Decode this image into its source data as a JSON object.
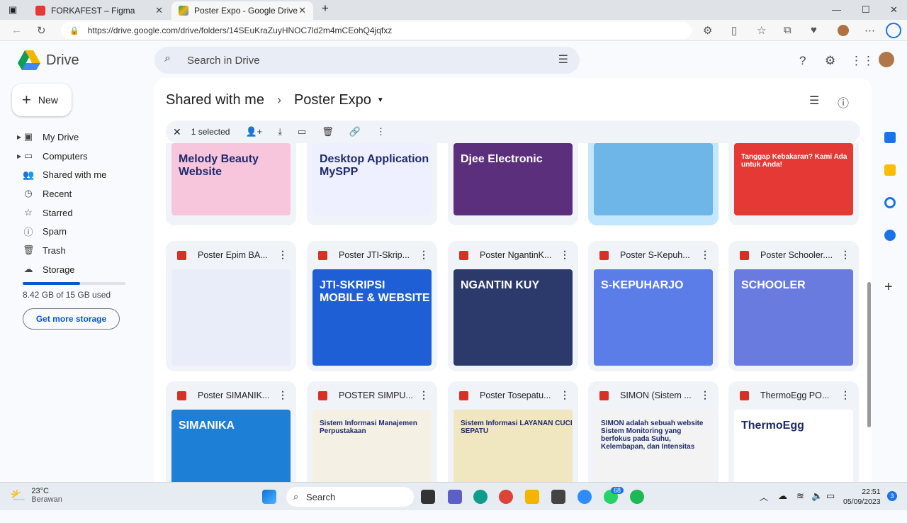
{
  "browser": {
    "tabs": [
      {
        "label": "FORKAFEST – Figma",
        "color": "#e53935"
      },
      {
        "label": "Poster Expo - Google Drive",
        "color": "#1a73e8"
      }
    ],
    "url": "https://drive.google.com/drive/folders/14SEuKraZuyHNOC7ld2m4mCEohQ4jqfxz"
  },
  "drive": {
    "app_name": "Drive",
    "search_placeholder": "Search in Drive",
    "new_label": "New",
    "sidebar": [
      {
        "label": "My Drive",
        "icon": "drive-icon"
      },
      {
        "label": "Computers",
        "icon": "computer-icon"
      },
      {
        "label": "Shared with me",
        "icon": "people-icon"
      },
      {
        "label": "Recent",
        "icon": "clock-icon"
      },
      {
        "label": "Starred",
        "icon": "star-icon"
      },
      {
        "label": "Spam",
        "icon": "spam-icon"
      },
      {
        "label": "Trash",
        "icon": "trash-icon"
      },
      {
        "label": "Storage",
        "icon": "cloud-icon"
      }
    ],
    "storage_text": "8.42 GB of 15 GB used",
    "storage_fraction": 0.56,
    "get_more_label": "Get more storage",
    "breadcrumb": {
      "parent": "Shared with me",
      "current": "Poster Expo"
    },
    "selection": {
      "count_label": "1 selected"
    },
    "files": [
      {
        "name": "",
        "thumb": "Melody Beauty Website",
        "color": "#f7c6dc"
      },
      {
        "name": "",
        "thumb": "Desktop Application MySPP",
        "color": "#eef0ff"
      },
      {
        "name": "",
        "thumb": "Djee Electronic",
        "color": "#5b2f7c"
      },
      {
        "name": "",
        "thumb": "",
        "color": "#6fb6e8"
      },
      {
        "name": "",
        "thumb": "Tanggap Kebakaran? Kami Ada untuk Anda!",
        "color": "#e53935"
      },
      {
        "name": "Poster Epim BA...",
        "thumb": "",
        "color": "#e9edf9"
      },
      {
        "name": "Poster JTI-Skrip...",
        "thumb": "JTI-SKRIPSI MOBILE & WEBSITE",
        "color": "#1e5fd6"
      },
      {
        "name": "Poster NgantinK...",
        "thumb": "NGANTIN KUY",
        "color": "#2c3a6b"
      },
      {
        "name": "Poster S-Kepuh...",
        "thumb": "S-KEPUHARJO",
        "color": "#5b7de8"
      },
      {
        "name": "Poster Schooler....",
        "thumb": "SCHOOLER",
        "color": "#6a7be0"
      },
      {
        "name": "Poster SIMANIK...",
        "thumb": "SIMANIKA",
        "color": "#1e7fd6"
      },
      {
        "name": "POSTER SIMPU...",
        "thumb": "Sistem Informasi Manajemen Perpustakaan",
        "color": "#f4f1e4"
      },
      {
        "name": "Poster Tosepatu...",
        "thumb": "Sistem Informasi LAYANAN CUCI SEPATU",
        "color": "#f0e6c0"
      },
      {
        "name": "SIMON (Sistem ...",
        "thumb": "SIMON adalah sebuah website Sistem Monitoring yang berfokus pada Suhu, Kelembapan, dan Intensitas",
        "color": "#f3f3f3"
      },
      {
        "name": "ThermoEgg PO...",
        "thumb": "ThermoEgg",
        "color": "#ffffff"
      }
    ]
  },
  "taskbar": {
    "weather_temp": "23°C",
    "weather_desc": "Berawan",
    "search_label": "Search",
    "time": "22:51",
    "date": "05/09/2023",
    "badge_whatsapp": "68",
    "notif_count": "3"
  }
}
